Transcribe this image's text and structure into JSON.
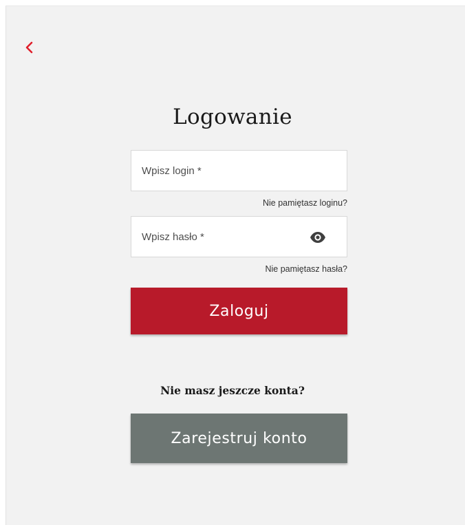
{
  "nav": {
    "back_icon": "chevron-left-icon",
    "accent_color": "#e01f2b"
  },
  "login": {
    "title": "Logowanie",
    "login_placeholder": "Wpisz login *",
    "login_value": "",
    "forgot_login": "Nie pamiętasz loginu?",
    "password_placeholder": "Wpisz hasło *",
    "password_value": "",
    "password_toggle_icon": "eye-icon",
    "forgot_password": "Nie pamiętasz hasła?",
    "submit_label": "Zaloguj",
    "submit_color": "#b81a2a"
  },
  "register": {
    "prompt": "Nie masz jeszcze konta?",
    "button_label": "Zarejestruj konto",
    "button_color": "#6d7673"
  }
}
